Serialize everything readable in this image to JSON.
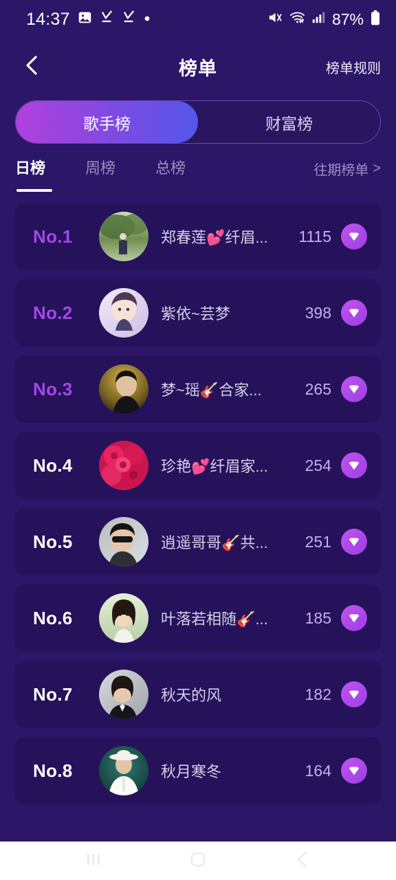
{
  "status_bar": {
    "time": "14:37",
    "battery_percent": "87%",
    "left_icons": [
      "gallery-icon",
      "download-complete-icon",
      "download-complete-icon",
      "dot-icon"
    ],
    "right_icons": [
      "mute-icon",
      "wifi-6-icon",
      "signal-bars-icon",
      "battery-icon"
    ]
  },
  "header": {
    "back_icon": "chevron-left-icon",
    "title": "榜单",
    "rules_label": "榜单规则"
  },
  "segment": {
    "active_index": 0,
    "options": [
      {
        "label": "歌手榜"
      },
      {
        "label": "财富榜"
      }
    ]
  },
  "tabs": {
    "active_index": 0,
    "items": [
      {
        "label": "日榜"
      },
      {
        "label": "周榜"
      },
      {
        "label": "总榜"
      }
    ],
    "past_label": "往期榜单",
    "past_chevron": ">"
  },
  "colors": {
    "page_bg": "#2b1668",
    "card_bg": "#25125a",
    "accent_purple": "#a347e8",
    "accent_blue": "#5356ea",
    "score_purple": "#c9aef0",
    "muted_text": "#9b8fc4",
    "name_text": "#d7cfe9"
  },
  "ranking": {
    "badge_icon": "gem-icon",
    "rows": [
      {
        "rank": "No.1",
        "rank_highlight": true,
        "name": "郑春莲💕纤眉...",
        "score": "1115",
        "avatar": "park-green"
      },
      {
        "rank": "No.2",
        "rank_highlight": true,
        "name": "紫依~芸梦",
        "score": "398",
        "avatar": "anime-lavender"
      },
      {
        "rank": "No.3",
        "rank_highlight": true,
        "name": "梦~瑶🎸合家...",
        "score": "265",
        "avatar": "gold-dark"
      },
      {
        "rank": "No.4",
        "rank_highlight": false,
        "name": "珍艳💕纤眉家...",
        "score": "254",
        "avatar": "pink-flowers"
      },
      {
        "rank": "No.5",
        "rank_highlight": false,
        "name": "逍遥哥哥🎸共...",
        "score": "251",
        "avatar": "man-sunglasses"
      },
      {
        "rank": "No.6",
        "rank_highlight": false,
        "name": "叶落若相随🎸...",
        "score": "185",
        "avatar": "woman-outdoor"
      },
      {
        "rank": "No.7",
        "rank_highlight": false,
        "name": "秋天的风",
        "score": "182",
        "avatar": "man-suit"
      },
      {
        "rank": "No.8",
        "rank_highlight": false,
        "name": "秋月寒冬",
        "score": "164",
        "avatar": "man-white-hat"
      }
    ]
  },
  "nav_bar": {
    "recents_icon": "recents-icon",
    "home_icon": "home-icon",
    "back_icon": "back-icon"
  }
}
